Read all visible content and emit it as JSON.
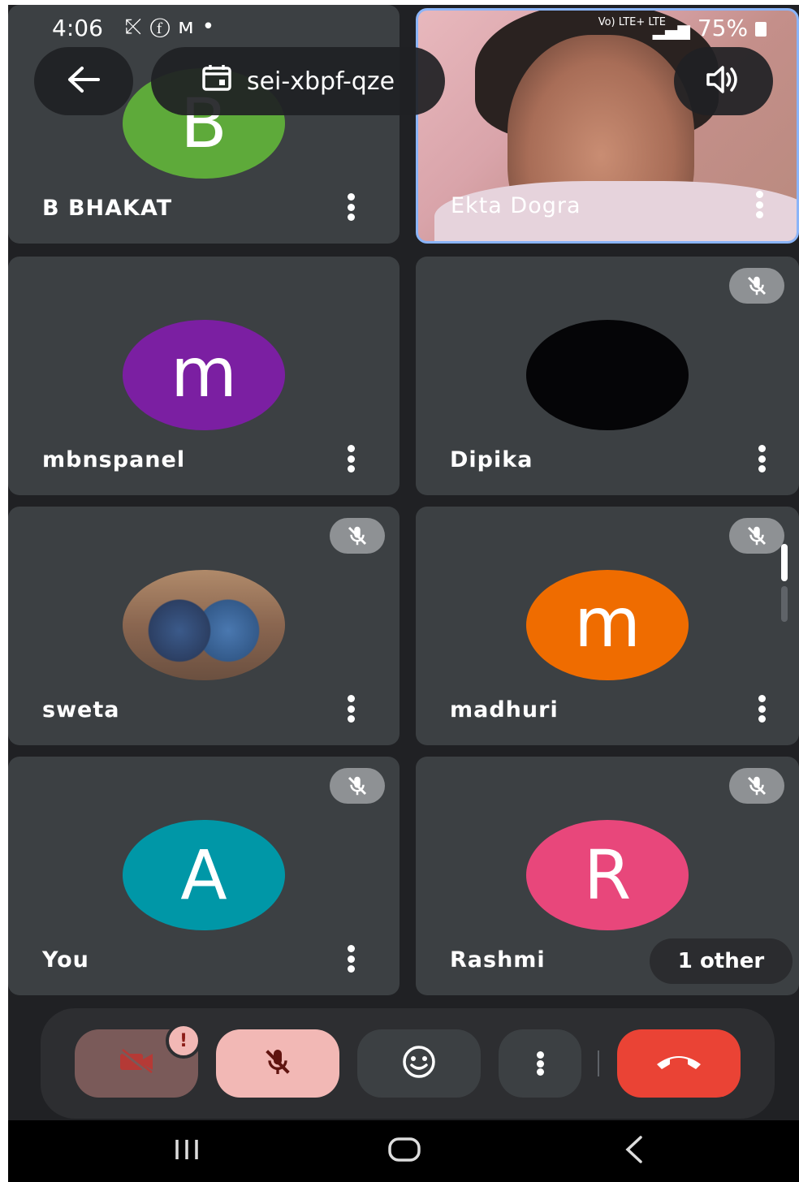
{
  "status_bar": {
    "time": "4:06",
    "notification_icons": [
      "missed-call-icon",
      "facebook-icon",
      "gmail-icon",
      "dot-icon"
    ],
    "network": "Vo) LTE+ LTE",
    "battery": "75%"
  },
  "header": {
    "meeting_code": "sei-xbpf-qze",
    "back_icon": "arrow-left-icon",
    "calendar_icon": "calendar-icon",
    "speaker_icon": "speaker-icon"
  },
  "participants": [
    {
      "name": "B BHAKAT",
      "initial": "B",
      "color": "#5eaa3a",
      "muted": false
    },
    {
      "name": "Ekta Dogra",
      "video": true
    },
    {
      "name": "mbnspanel",
      "initial": "m",
      "color": "#7b1fa2",
      "muted": false
    },
    {
      "name": "Dipika",
      "initial": "",
      "color": "#050507",
      "muted": true
    },
    {
      "name": "sweta",
      "photo": true,
      "muted": true
    },
    {
      "name": "madhuri",
      "initial": "m",
      "color": "#ef6c00",
      "muted": true
    },
    {
      "name": "You",
      "initial": "A",
      "color": "#0097a7",
      "muted": true
    },
    {
      "name": "Rashmi",
      "initial": "R",
      "color": "#e8477b",
      "muted": true
    }
  ],
  "others_badge": "1 other",
  "controls": {
    "camera_icon": "camera-off-icon",
    "camera_alert": "!",
    "mic_icon": "mic-off-icon",
    "reactions_icon": "emoji-icon",
    "more_icon": "more-vert-icon",
    "end_call_icon": "end-call-icon",
    "camera_bg": "#7a5a59",
    "mic_bg": "#f2b8b5",
    "end_call_bg": "#ea4335"
  },
  "nav": {
    "recents_icon": "recents-icon",
    "home_icon": "home-icon",
    "back_icon": "back-icon"
  }
}
